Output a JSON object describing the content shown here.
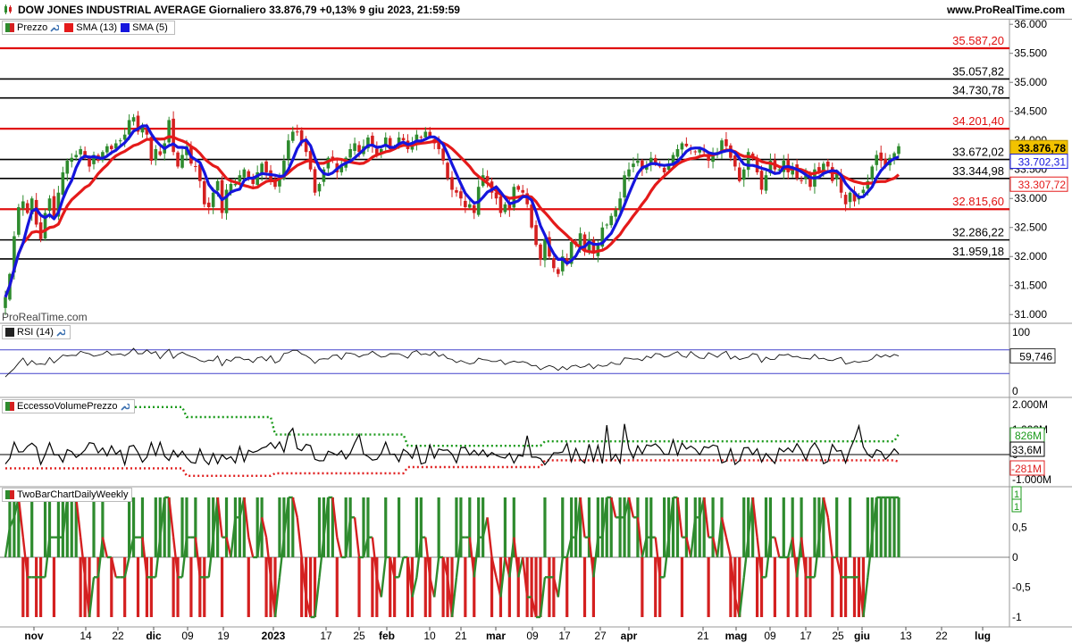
{
  "header": {
    "title": "DOW JONES INDUSTRIAL AVERAGE Giornaliero 33.876,79 +0,13% 9 giu 2023, 21:59:59",
    "brand": "www.ProRealTime.com",
    "watermark": "ProRealTime.com"
  },
  "colors": {
    "up": "#2e8b2e",
    "down": "#d42020",
    "sma13": "#e41a1a",
    "sma5": "#1515dd",
    "last_price_bg": "#f2c200"
  },
  "legends": {
    "price": [
      {
        "label": "Prezzo",
        "color": "#2e8b2e"
      },
      {
        "label": "SMA (13)",
        "color": "#e41a1a"
      },
      {
        "label": "SMA (5)",
        "color": "#1515dd"
      }
    ],
    "rsi": "RSI (14)",
    "evp": "EccessoVolumePrezzo",
    "tbc": "TwoBarChartDailyWeekly"
  },
  "x_labels": [
    "nov",
    "14",
    "22",
    "dic",
    "09",
    "19",
    "2023",
    "17",
    "25",
    "feb",
    "10",
    "21",
    "mar",
    "09",
    "17",
    "27",
    "apr",
    "21",
    "mag",
    "09",
    "17",
    "25",
    "giu",
    "13",
    "22",
    "lug"
  ],
  "chart_data": [
    {
      "type": "candlestick",
      "name": "price",
      "ylim": [
        30850,
        36080
      ],
      "y_ticks": [
        "36.000",
        "35.500",
        "35.000",
        "34.500",
        "34.000",
        "33.500",
        "33.000",
        "32.500",
        "32.000",
        "31.500",
        "31.000"
      ],
      "horizontal_lines": [
        {
          "label": "35.587,20",
          "value": 35587.2,
          "color": "red"
        },
        {
          "label": "35.057,82",
          "value": 35057.82,
          "color": "black"
        },
        {
          "label": "34.730,78",
          "value": 34730.78,
          "color": "black"
        },
        {
          "label": "34.201,40",
          "value": 34201.4,
          "color": "red"
        },
        {
          "label": "33.672,02",
          "value": 33672.02,
          "color": "black"
        },
        {
          "label": "33.344,98",
          "value": 33344.98,
          "color": "black"
        },
        {
          "label": "32.815,60",
          "value": 32815.6,
          "color": "red"
        },
        {
          "label": "32.286,22",
          "value": 32286.22,
          "color": "black"
        },
        {
          "label": "31.959,18",
          "value": 31959.18,
          "color": "black"
        }
      ],
      "last_price": {
        "label": "33.876,78",
        "value": 33876.78
      },
      "sma5_last": {
        "label": "33.702,31",
        "value": 33702.31
      },
      "sma13_last": {
        "label": "33.307,72",
        "value": 33307.72
      },
      "closes": [
        31300,
        31700,
        32350,
        32850,
        32950,
        32750,
        33000,
        32550,
        32300,
        32750,
        33000,
        32650,
        33100,
        33450,
        33650,
        33700,
        33750,
        33850,
        33700,
        33550,
        33750,
        33650,
        33800,
        33900,
        33850,
        33950,
        34000,
        34100,
        34350,
        34400,
        34150,
        34250,
        34100,
        33650,
        33850,
        33750,
        33950,
        34350,
        33800,
        33550,
        33750,
        33900,
        33600,
        33550,
        33300,
        32900,
        32850,
        33100,
        33300,
        32750,
        33150,
        33250,
        33250,
        33400,
        33500,
        33350,
        33250,
        33450,
        33600,
        33450,
        33300,
        33200,
        33350,
        33650,
        34000,
        34150,
        34150,
        33950,
        33800,
        33500,
        33100,
        33250,
        33500,
        33700,
        33650,
        33450,
        33550,
        33700,
        33850,
        33950,
        33800,
        33900,
        34050,
        33900,
        33750,
        33850,
        34050,
        33850,
        33900,
        34050,
        34000,
        33850,
        33950,
        34100,
        34050,
        34150,
        34050,
        33950,
        33850,
        33650,
        33350,
        33150,
        33100,
        33000,
        32850,
        32900,
        32750,
        33200,
        33400,
        33300,
        33100,
        33000,
        32750,
        32900,
        32800,
        33200,
        33150,
        33100,
        32900,
        32500,
        32200,
        31950,
        32300,
        32000,
        31800,
        31700,
        32000,
        31900,
        32250,
        32200,
        32400,
        32100,
        32300,
        32050,
        32200,
        32500,
        32550,
        32700,
        32800,
        33000,
        33400,
        33500,
        33600,
        33650,
        33500,
        33550,
        33700,
        33600,
        33550,
        33450,
        33600,
        33750,
        33850,
        33950,
        33900,
        33850,
        33800,
        33850,
        33800,
        33650,
        33750,
        33800,
        34000,
        33900,
        33700,
        33550,
        33300,
        33500,
        33800,
        33700,
        33450,
        33150,
        33400,
        33650,
        33500,
        33500,
        33650,
        33450,
        33550,
        33350,
        33300,
        33400,
        33200,
        33500,
        33450,
        33600,
        33550,
        33300,
        33450,
        33100,
        32900,
        33100,
        32950,
        33050,
        33150,
        33300,
        33550,
        33750,
        33650,
        33550,
        33700,
        33780,
        33900
      ]
    },
    {
      "type": "line",
      "name": "RSI (14)",
      "ylim": [
        0,
        100
      ],
      "y_ticks": [
        "100",
        "0"
      ],
      "last": {
        "label": "59,746",
        "value": 59.746
      }
    },
    {
      "type": "line",
      "name": "EccessoVolumePrezzo",
      "ylim": [
        -1200,
        2200
      ],
      "y_ticks": [
        "2.000M",
        "1.000M",
        "0",
        "-1.000M"
      ],
      "upper_last": {
        "label": "826M",
        "value": 826
      },
      "main_last": {
        "label": "33,6M",
        "value": 33.6
      },
      "lower_last": {
        "label": "-281M",
        "value": -281
      }
    },
    {
      "type": "line",
      "name": "TwoBarChartDailyWeekly",
      "ylim": [
        -1.1,
        1.1
      ],
      "y_ticks": [
        "1",
        "0,5",
        "0",
        "-0,5",
        "-1"
      ],
      "last_labels": [
        "1",
        "1"
      ]
    }
  ]
}
